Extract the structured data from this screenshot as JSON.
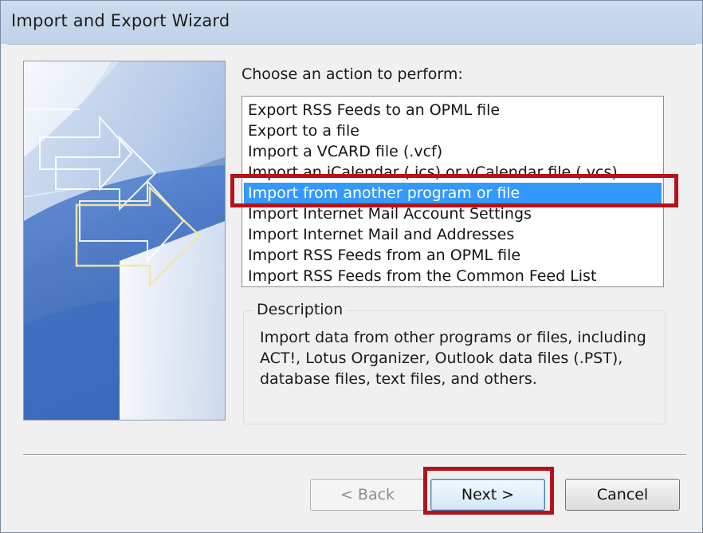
{
  "window": {
    "title": "Import and Export Wizard"
  },
  "wizard": {
    "prompt": "Choose an action to perform:",
    "actions": [
      "Export RSS Feeds to an OPML file",
      "Export to a file",
      "Import a VCARD file (.vcf)",
      "Import an iCalendar (.ics) or vCalendar file (.vcs)",
      "Import from another program or file",
      "Import Internet Mail Account Settings",
      "Import Internet Mail and Addresses",
      "Import RSS Feeds from an OPML file",
      "Import RSS Feeds from the Common Feed List"
    ],
    "selected_index": 4,
    "description_label": "Description",
    "description_text": "Import data from other programs or files, including ACT!, Lotus Organizer, Outlook data files (.PST), database files, text files, and others."
  },
  "buttons": {
    "back_label": "< Back",
    "back_enabled": false,
    "next_label": "Next >",
    "cancel_label": "Cancel"
  },
  "colors": {
    "selection": "#3399ff",
    "annotation_red": "#b5121b"
  }
}
